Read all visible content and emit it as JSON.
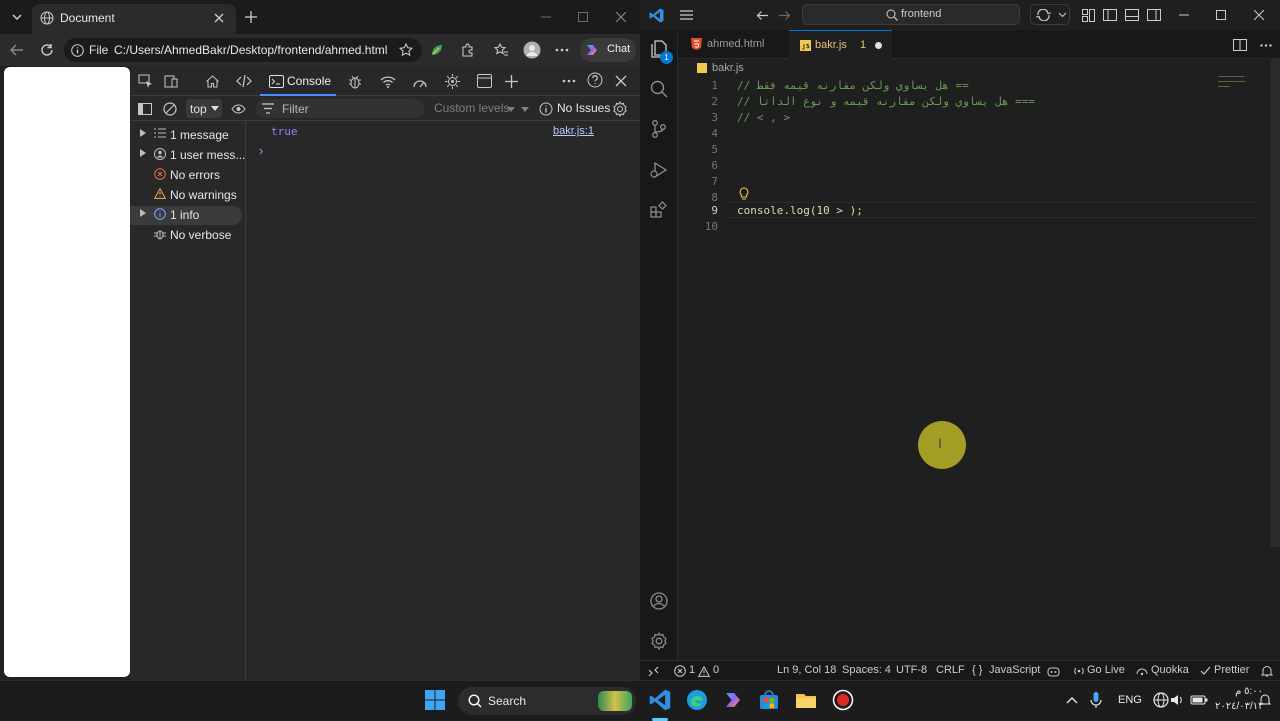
{
  "browser": {
    "tab_title": "Document",
    "address_scheme": "File",
    "address_url": "C:/Users/AhmedBakr/Desktop/frontend/ahmed.html",
    "chat_label": "Chat"
  },
  "devtools": {
    "active_tab": "Console",
    "context": "top",
    "filter_placeholder": "Filter",
    "levels": "Custom levels",
    "issues": "No Issues",
    "sidebar": [
      {
        "label": "1 message",
        "icon": "list-icon",
        "expandable": true
      },
      {
        "label": "1 user mess...",
        "icon": "user-icon",
        "expandable": true
      },
      {
        "label": "No errors",
        "icon": "error-icon",
        "expandable": false
      },
      {
        "label": "No warnings",
        "icon": "warning-icon",
        "expandable": false
      },
      {
        "label": "1 info",
        "icon": "info-icon",
        "expandable": true
      },
      {
        "label": "No verbose",
        "icon": "bug-icon",
        "expandable": false
      }
    ],
    "console_output": "true",
    "console_source": "bakr.js:1",
    "prompt": "›"
  },
  "vscode": {
    "search": "frontend",
    "tabs": [
      {
        "name": "ahmed.html",
        "active": false
      },
      {
        "name": "bakr.js",
        "active": true,
        "problems": "1"
      }
    ],
    "breadcrumb": "bakr.js",
    "explorer_badge": "1",
    "lines": [
      {
        "n": "1",
        "text": "// هل يساوي ولكن مقارنه قيمه فقط =="
      },
      {
        "n": "2",
        "text": "// هل يساوي ولكن مقارنه قيمه و نوع الداتا ==="
      },
      {
        "n": "3",
        "text": "// < , >"
      },
      {
        "n": "4",
        "text": ""
      },
      {
        "n": "5",
        "text": ""
      },
      {
        "n": "6",
        "text": ""
      },
      {
        "n": "7",
        "text": ""
      },
      {
        "n": "8",
        "text": ""
      },
      {
        "n": "9",
        "text": "console.log(10 > );"
      },
      {
        "n": "10",
        "text": ""
      }
    ],
    "status": {
      "errors": "1",
      "warnings": "0",
      "position": "Ln 9, Col 18",
      "spaces": "Spaces: 4",
      "encoding": "UTF-8",
      "eol": "CRLF",
      "language": "JavaScript",
      "golive": "Go Live",
      "quokka": "Quokka",
      "prettier": "Prettier"
    }
  },
  "taskbar": {
    "search_label": "Search",
    "lang": "ENG",
    "time": "٥:٠٠ م",
    "date": "٢٠٢٤/٠٣/١٣"
  },
  "colors": {
    "accent_blue": "#0078d4",
    "comment_green": "#6a9955",
    "string_orange": "#ce9178",
    "function_yellow": "#dcdcaa",
    "number_green": "#b5cea8",
    "keyword_blue": "#569cd6",
    "link_blue": "#7aa6ff"
  }
}
